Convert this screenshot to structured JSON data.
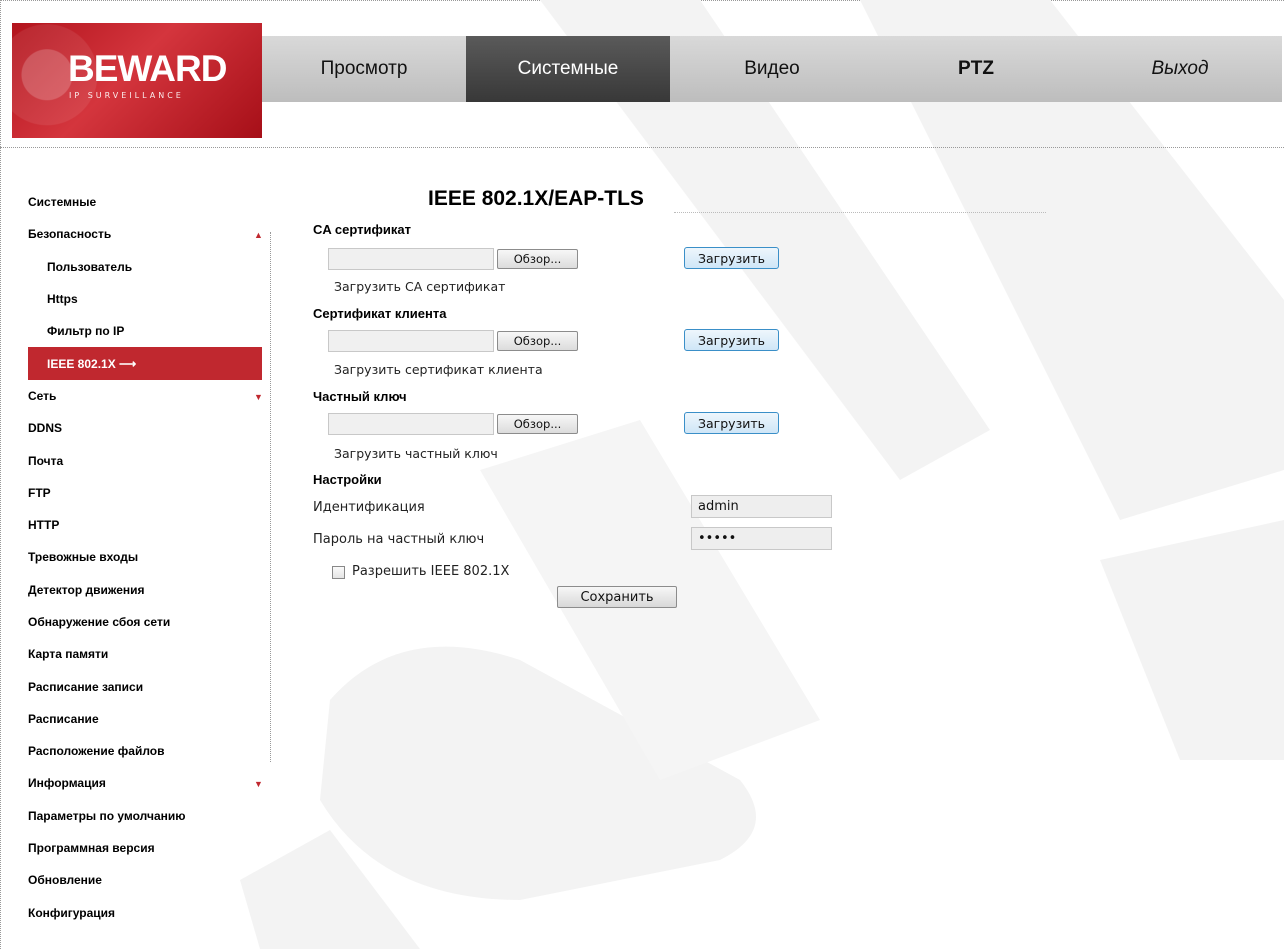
{
  "logo": {
    "text": "BEWARD",
    "sub": "IP SURVEILLANCE"
  },
  "nav": [
    {
      "label": "Просмотр"
    },
    {
      "label": "Системные"
    },
    {
      "label": "Видео"
    },
    {
      "label": "PTZ"
    },
    {
      "label": "Выход"
    }
  ],
  "sidebar": {
    "items": [
      {
        "label": "Системные"
      },
      {
        "label": "Безопасность",
        "arrow": "▲"
      },
      {
        "label": "Пользователь"
      },
      {
        "label": "Https"
      },
      {
        "label": "Фильтр по IP"
      },
      {
        "label": "IEEE 802.1X ⟶"
      },
      {
        "label": "Сеть",
        "arrow": "▼"
      },
      {
        "label": "DDNS"
      },
      {
        "label": "Почта"
      },
      {
        "label": "FTP"
      },
      {
        "label": "HTTP"
      },
      {
        "label": "Тревожные входы"
      },
      {
        "label": "Детектор движения"
      },
      {
        "label": "Обнаружение сбоя сети"
      },
      {
        "label": "Карта памяти"
      },
      {
        "label": "Расписание записи"
      },
      {
        "label": "Расписание"
      },
      {
        "label": "Расположение файлов"
      },
      {
        "label": "Информация",
        "arrow": "▼"
      },
      {
        "label": "Параметры по умолчанию"
      },
      {
        "label": "Программная версия"
      },
      {
        "label": "Обновление"
      },
      {
        "label": "Конфигурация"
      }
    ]
  },
  "main": {
    "title": "IEEE 802.1X/EAP-TLS",
    "ca": {
      "heading": "CA сертификат",
      "browse": "Обзор...",
      "upload": "Загрузить",
      "note": "Загрузить CA сертификат"
    },
    "client": {
      "heading": "Сертификат клиента",
      "browse": "Обзор...",
      "upload": "Загрузить",
      "note": "Загрузить сертификат клиента"
    },
    "key": {
      "heading": "Частный ключ",
      "browse": "Обзор...",
      "upload": "Загрузить",
      "note": "Загрузить частный ключ"
    },
    "settings": {
      "heading": "Настройки",
      "identity_label": "Идентификация",
      "identity_value": "admin",
      "password_label": "Пароль на частный ключ",
      "password_value": "•••••",
      "enable_label": "Разрешить IEEE 802.1X",
      "enable_checked": false,
      "save": "Сохранить"
    }
  },
  "colors": {
    "accent": "#c0282f",
    "nav_bg": "#c8c8c8",
    "nav_active": "#444444",
    "watermark": "#f2f2f2"
  }
}
